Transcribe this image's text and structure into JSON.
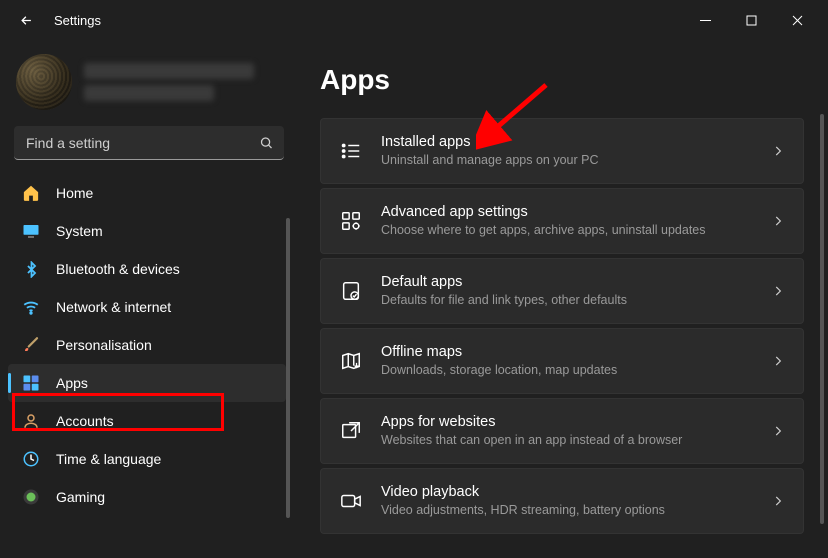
{
  "window": {
    "title": "Settings"
  },
  "search": {
    "placeholder": "Find a setting"
  },
  "nav": [
    {
      "id": "home",
      "label": "Home"
    },
    {
      "id": "system",
      "label": "System"
    },
    {
      "id": "bluetooth",
      "label": "Bluetooth & devices"
    },
    {
      "id": "network",
      "label": "Network & internet"
    },
    {
      "id": "personalisation",
      "label": "Personalisation"
    },
    {
      "id": "apps",
      "label": "Apps",
      "selected": true
    },
    {
      "id": "accounts",
      "label": "Accounts"
    },
    {
      "id": "time",
      "label": "Time & language"
    },
    {
      "id": "gaming",
      "label": "Gaming"
    }
  ],
  "page": {
    "title": "Apps",
    "items": [
      {
        "id": "installed",
        "title": "Installed apps",
        "desc": "Uninstall and manage apps on your PC"
      },
      {
        "id": "advanced",
        "title": "Advanced app settings",
        "desc": "Choose where to get apps, archive apps, uninstall updates"
      },
      {
        "id": "default",
        "title": "Default apps",
        "desc": "Defaults for file and link types, other defaults"
      },
      {
        "id": "maps",
        "title": "Offline maps",
        "desc": "Downloads, storage location, map updates"
      },
      {
        "id": "websites",
        "title": "Apps for websites",
        "desc": "Websites that can open in an app instead of a browser"
      },
      {
        "id": "video",
        "title": "Video playback",
        "desc": "Video adjustments, HDR streaming, battery options"
      }
    ]
  }
}
